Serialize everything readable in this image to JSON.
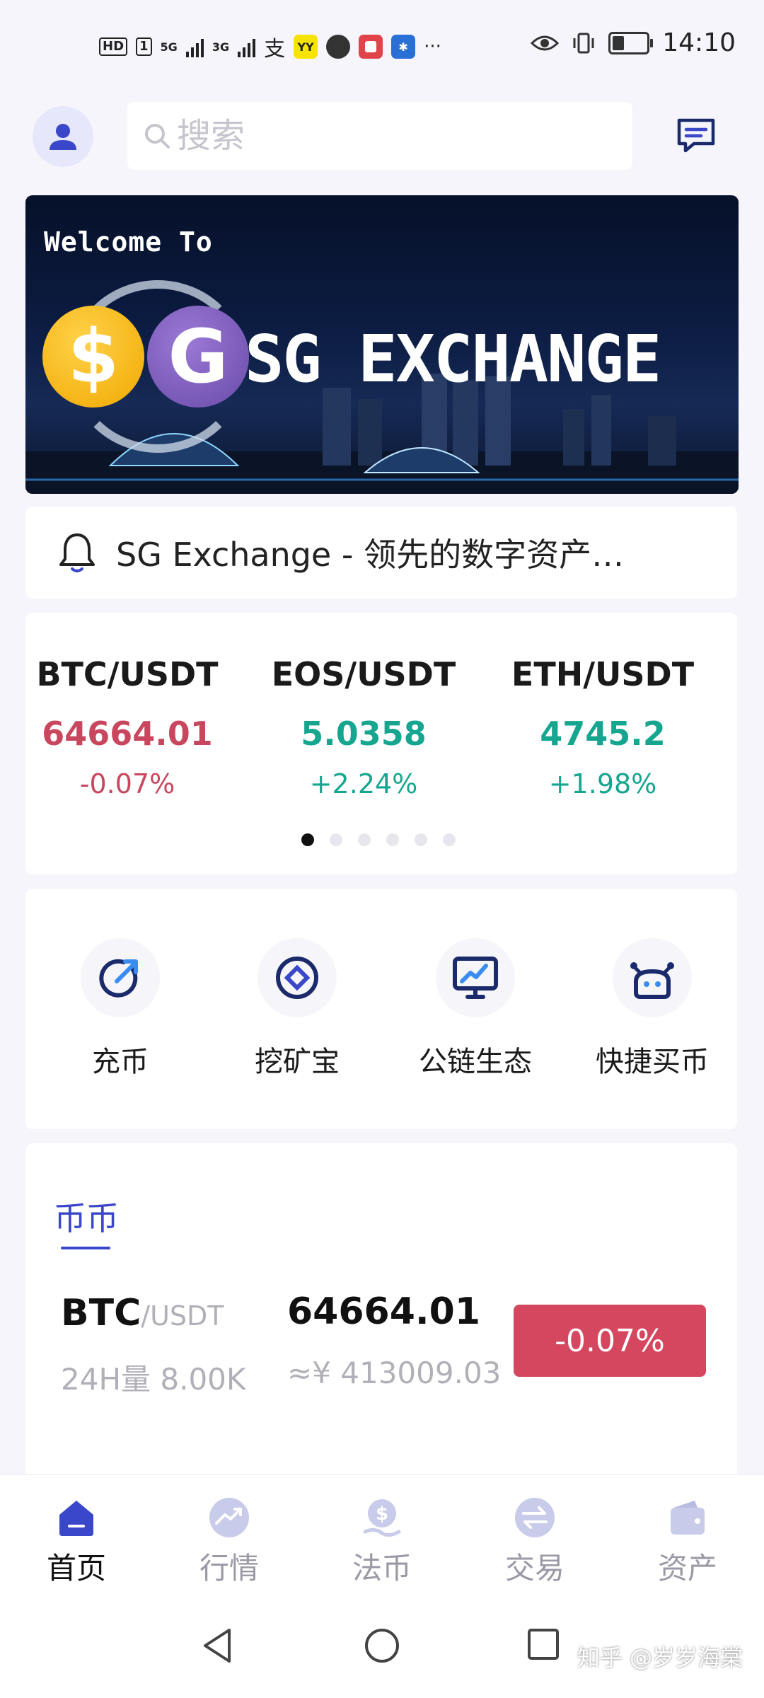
{
  "status_bar": {
    "hd_chip": "HD",
    "sim_chip": "1",
    "net1": "5G",
    "net2": "3G",
    "app_yy": "YY",
    "more": "···",
    "time": "14:10"
  },
  "header": {
    "search_placeholder": "搜索"
  },
  "banner": {
    "welcome": "Welcome To",
    "logo_s": "$",
    "logo_g": "G",
    "brand": "SG EXCHANGE"
  },
  "notice": {
    "text": "SG Exchange - 领先的数字资产…"
  },
  "ticker": {
    "items": [
      {
        "pair": "BTC/USDT",
        "price": "64664.01",
        "change": "-0.07%",
        "trend": "down"
      },
      {
        "pair": "EOS/USDT",
        "price": "5.0358",
        "change": "+2.24%",
        "trend": "up"
      },
      {
        "pair": "ETH/USDT",
        "price": "4745.2",
        "change": "+1.98%",
        "trend": "up"
      }
    ],
    "pages": 6,
    "active_page": 0
  },
  "quick_menu": [
    {
      "label": "充币",
      "icon": "deposit-arrow-icon"
    },
    {
      "label": "挖矿宝",
      "icon": "mining-icon"
    },
    {
      "label": "公链生态",
      "icon": "monitor-chart-icon"
    },
    {
      "label": "快捷买币",
      "icon": "robot-icon"
    }
  ],
  "market": {
    "tab": "币币",
    "rows": [
      {
        "base": "BTC",
        "quote": "/USDT",
        "volume": "24H量 8.00K",
        "price": "64664.01",
        "cny": "≈¥ 413009.03",
        "change": "-0.07%"
      }
    ]
  },
  "bottom_nav": [
    {
      "label": "首页",
      "icon": "home-icon",
      "active": true
    },
    {
      "label": "行情",
      "icon": "market-trend-icon",
      "active": false
    },
    {
      "label": "法币",
      "icon": "fiat-coin-icon",
      "active": false
    },
    {
      "label": "交易",
      "icon": "exchange-icon",
      "active": false
    },
    {
      "label": "资产",
      "icon": "wallet-icon",
      "active": false
    }
  ],
  "watermark": "知乎 @岁岁海棠",
  "colors": {
    "accent": "#3a47c9",
    "down": "#c9475e",
    "up": "#16a690",
    "badge_down": "#d4475f"
  }
}
